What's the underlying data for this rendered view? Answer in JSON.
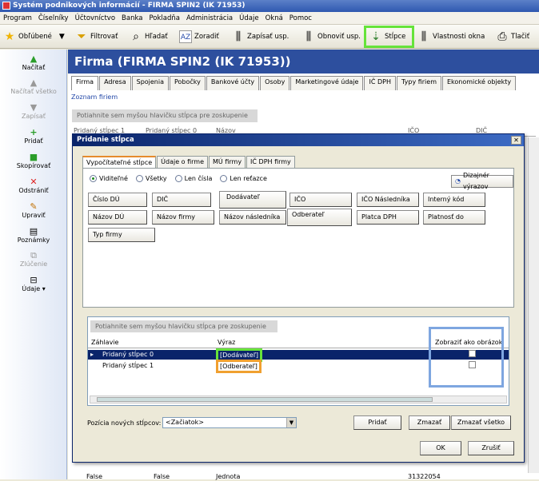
{
  "window": {
    "title": "Systém podnikových informácií - FIRMA SPIN2 (IK 71953)"
  },
  "menu": [
    "Program",
    "Číselníky",
    "Účtovníctvo",
    "Banka",
    "Pokladňa",
    "Administrácia",
    "Údaje",
    "Okná",
    "Pomoc"
  ],
  "toolbar": {
    "favorites": "Obľúbené",
    "filter": "Filtrovať",
    "search": "Hľadať",
    "sort": "Zoradiť",
    "write_settings": "Zapísať usp.",
    "restore_settings": "Obnoviť usp.",
    "columns": "Stĺpce",
    "window_props": "Vlastnosti okna",
    "print": "Tlačiť"
  },
  "sidebar": [
    "Načítať",
    "Načítať všetko",
    "Zapísať",
    "Pridať",
    "Skopírovať",
    "Odstrániť",
    "Upraviť",
    "Poznámky",
    "Zlúčenie",
    "Údaje"
  ],
  "main": {
    "title": "Firma (FIRMA SPIN2 (IK 71953))",
    "tabs": [
      "Firma",
      "Adresa",
      "Spojenia",
      "Pobočky",
      "Bankové účty",
      "Osoby",
      "Marketingové údaje",
      "IČ DPH",
      "Typy firiem",
      "Ekonomické objekty"
    ],
    "sub_label": "Zoznam firiem",
    "group_hint": "Potiahnite sem myšou hlavičku stĺpca pre zoskupenie",
    "grid_header": [
      "Pridaný stĺpec 1",
      "Pridaný stĺpec 0",
      "Názov",
      "IČO",
      "DIČ"
    ],
    "bottom_row": [
      "False",
      "False",
      "Jednota",
      "31322054"
    ]
  },
  "dialog": {
    "title": "Pridanie stĺpca",
    "tabs": [
      "Vypočítateľné stĺpce",
      "Údaje o firme",
      "MÚ firmy",
      "IČ DPH firmy"
    ],
    "radios": [
      "Viditeľné",
      "Všetky",
      "Len čísla",
      "Len reťazce"
    ],
    "designer": "Dizajnér výrazov",
    "fields": [
      "Číslo DÚ",
      "DIČ",
      "Dodávateľ",
      "IČO",
      "IČO Následníka",
      "Interný kód",
      "Názov DÚ",
      "Názov firmy",
      "Názov následníka",
      "Odberateľ",
      "Platca DPH",
      "Platnosť do",
      "Typ firmy"
    ],
    "grid_hint": "Potiahnite sem myšou hlavičku stĺpca pre zoskupenie",
    "grid_cols": [
      "Záhlavie",
      "Výraz",
      "Zobraziť ako obrázok"
    ],
    "rows": [
      {
        "header": "Pridaný stĺpec 0",
        "expr": "[Dodávateľ]"
      },
      {
        "header": "Pridaný stĺpec 1",
        "expr": "[Odberateľ]"
      }
    ],
    "position_label": "Pozícia nových stĺpcov:",
    "position_value": "<Začiatok>",
    "add": "Pridať",
    "delete": "Zmazať",
    "delete_all": "Zmazať všetko",
    "ok": "OK",
    "cancel": "Zrušiť"
  },
  "colors": {
    "highlight_green": "#66e33a",
    "highlight_orange": "#f0a030",
    "highlight_blue": "#7ea6e0",
    "header_blue": "#2d4f9e"
  }
}
